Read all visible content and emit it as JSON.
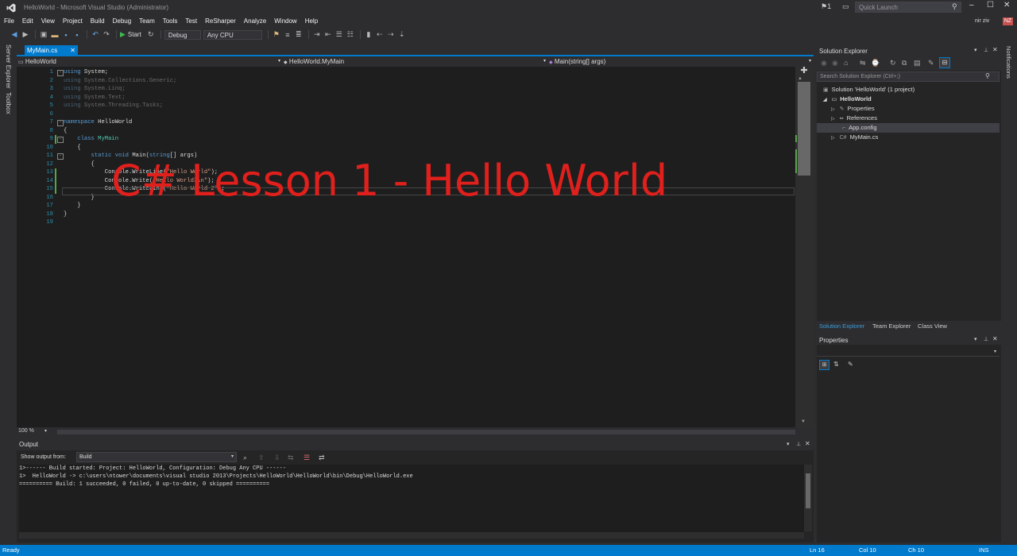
{
  "window": {
    "title": "HelloWorld - Microsoft Visual Studio (Administrator)",
    "notification_count": "1",
    "quick_launch_placeholder": "Quick Launch",
    "user_name": "nir ziv",
    "user_initials": "NZ"
  },
  "menu": [
    "File",
    "Edit",
    "View",
    "Project",
    "Build",
    "Debug",
    "Team",
    "Tools",
    "Test",
    "ReSharper",
    "Analyze",
    "Window",
    "Help"
  ],
  "toolbar": {
    "start_label": "Start",
    "configuration": "Debug",
    "platform": "Any CPU"
  },
  "left_tabs": [
    "Server Explorer",
    "Toolbox"
  ],
  "editor": {
    "active_tab": "MyMain.cs",
    "nav_project": "HelloWorld",
    "nav_class": "HelloWorld.MyMain",
    "nav_member": "Main(string[] args)",
    "zoom": "100 %",
    "overlay_title": "C# Lesson 1 - Hello World",
    "lines": [
      {
        "n": "1",
        "fold": "-",
        "parts": [
          [
            "kw",
            "using"
          ],
          [
            "plain",
            " System;"
          ]
        ]
      },
      {
        "n": "2",
        "parts": [
          [
            "kwdim",
            "using"
          ],
          [
            "dim",
            " System.Collections.Generic;"
          ]
        ]
      },
      {
        "n": "3",
        "parts": [
          [
            "kwdim",
            "using"
          ],
          [
            "dim",
            " System.Linq;"
          ]
        ]
      },
      {
        "n": "4",
        "parts": [
          [
            "kwdim",
            "using"
          ],
          [
            "dim",
            " System.Text;"
          ]
        ]
      },
      {
        "n": "5",
        "parts": [
          [
            "kwdim",
            "using"
          ],
          [
            "dim",
            " System.Threading.Tasks;"
          ]
        ]
      },
      {
        "n": "6",
        "parts": []
      },
      {
        "n": "7",
        "fold": "-",
        "parts": [
          [
            "kw",
            "namespace"
          ],
          [
            "plain",
            " HelloWorld"
          ]
        ]
      },
      {
        "n": "8",
        "parts": [
          [
            "plain",
            "{"
          ]
        ]
      },
      {
        "n": "9",
        "fold": "-",
        "change": true,
        "parts": [
          [
            "plain",
            "    "
          ],
          [
            "kw",
            "class"
          ],
          [
            "plain",
            " "
          ],
          [
            "type",
            "MyMain"
          ]
        ]
      },
      {
        "n": "10",
        "parts": [
          [
            "plain",
            "    {"
          ]
        ]
      },
      {
        "n": "11",
        "fold": "-",
        "parts": [
          [
            "plain",
            "        "
          ],
          [
            "kw",
            "static"
          ],
          [
            "plain",
            " "
          ],
          [
            "kw",
            "void"
          ],
          [
            "plain",
            " Main("
          ],
          [
            "kw",
            "string"
          ],
          [
            "plain",
            "[] args)"
          ]
        ]
      },
      {
        "n": "12",
        "parts": [
          [
            "plain",
            "        {"
          ]
        ]
      },
      {
        "n": "13",
        "change": true,
        "parts": [
          [
            "plain",
            "            Console.WriteLine("
          ],
          [
            "str",
            "\"Hello World\""
          ],
          [
            "plain",
            ");"
          ]
        ]
      },
      {
        "n": "14",
        "change": true,
        "parts": [
          [
            "plain",
            "            Console.Write("
          ],
          [
            "str",
            "\"Hello World3\\n\""
          ],
          [
            "plain",
            ");"
          ]
        ]
      },
      {
        "n": "15",
        "change": true,
        "parts": [
          [
            "plain",
            "            Console.WriteLine("
          ],
          [
            "str",
            "\"Hello World 2\""
          ],
          [
            "plain",
            ");"
          ]
        ]
      },
      {
        "n": "16",
        "parts": [
          [
            "plain",
            "        }"
          ]
        ]
      },
      {
        "n": "17",
        "parts": [
          [
            "plain",
            "    }"
          ]
        ]
      },
      {
        "n": "18",
        "parts": [
          [
            "plain",
            "}"
          ]
        ]
      },
      {
        "n": "19",
        "parts": []
      }
    ]
  },
  "output": {
    "title": "Output",
    "show_from_label": "Show output from:",
    "source": "Build",
    "lines": [
      "1>------ Build started: Project: HelloWorld, Configuration: Debug Any CPU ------",
      "1>  HelloWorld -> c:\\users\\ntower\\documents\\visual studio 2013\\Projects\\HelloWorld\\HelloWorld\\bin\\Debug\\HelloWorld.exe",
      "========== Build: 1 succeeded, 0 failed, 0 up-to-date, 0 skipped =========="
    ]
  },
  "solution_explorer": {
    "title": "Solution Explorer",
    "search_placeholder": "Search Solution Explorer (Ctrl+;)",
    "solution": "Solution 'HelloWorld' (1 project)",
    "project": "HelloWorld",
    "properties": "Properties",
    "references": "References",
    "app_config": "App.config",
    "mymain": "MyMain.cs",
    "tabs": [
      "Solution Explorer",
      "Team Explorer",
      "Class View"
    ]
  },
  "properties_panel": {
    "title": "Properties"
  },
  "right_tabs": [
    "Notifications"
  ],
  "status": {
    "state": "Ready",
    "ln": "Ln 16",
    "col": "Col 10",
    "ch": "Ch 10",
    "mode": "INS"
  },
  "colors": {
    "accent": "#007acc",
    "overlay_red": "#e0201c",
    "change_green": "#57a64a"
  }
}
